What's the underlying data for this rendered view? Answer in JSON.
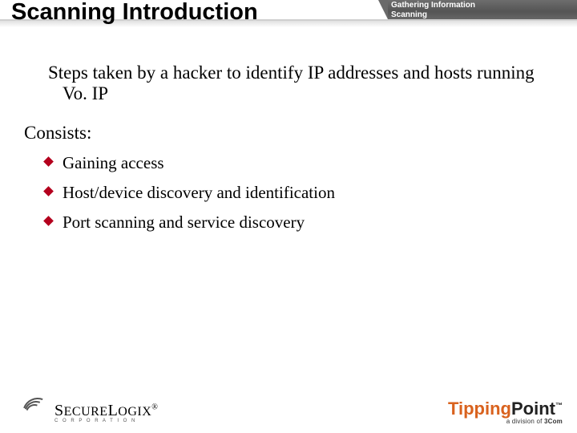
{
  "header": {
    "title": "Scanning Introduction",
    "breadcrumb_line1": "Gathering Information",
    "breadcrumb_line2": "Scanning"
  },
  "content": {
    "lead": "Steps taken by a hacker to identify IP addresses and hosts running Vo. IP",
    "subhead": "Consists:",
    "bullets": [
      "Gaining access",
      "Host/device discovery and identification",
      "Port scanning and service discovery"
    ]
  },
  "footer": {
    "left_logo_text": "SecureLogix",
    "left_logo_suffix": "®",
    "left_logo_sub": "C O R P O R A T I O N",
    "right_logo_part1": "Tipping",
    "right_logo_part2": "Point",
    "right_logo_tm": "™",
    "right_logo_sub": "a division of 3Com"
  }
}
